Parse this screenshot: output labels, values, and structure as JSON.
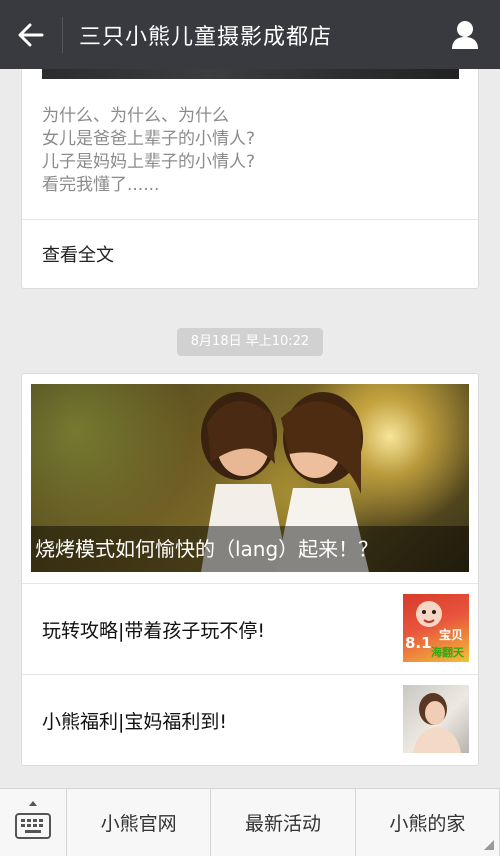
{
  "header": {
    "title": "三只小熊儿童摄影成都店",
    "back_icon": "arrow-left-icon",
    "profile_icon": "person-icon"
  },
  "previous_article": {
    "summary_lines": [
      "为什么、为什么、为什么",
      "女儿是爸爸上辈子的小情人?",
      "儿子是妈妈上辈子的小情人?",
      "看完我懂了......"
    ],
    "read_more": "查看全文"
  },
  "timestamp": "8月18日 早上10:22",
  "news": {
    "hero_caption": "烧烤模式如何愉快的（lang）起来！？",
    "items": [
      {
        "title": "玩转攻略|带着孩子玩不停!",
        "thumb_text_top": "宝贝",
        "thumb_text_num": "8.1",
        "thumb_text_bottom": "海翻天"
      },
      {
        "title": "小熊福利|宝妈福利到!"
      }
    ]
  },
  "bottom_menu": {
    "keyboard_icon": "keyboard-icon",
    "items": [
      "小熊官网",
      "最新活动",
      "小熊的家"
    ]
  },
  "colors": {
    "topbar": "#393a3f",
    "background": "#ebebeb",
    "timestamp_bg": "#d1d1d1"
  }
}
